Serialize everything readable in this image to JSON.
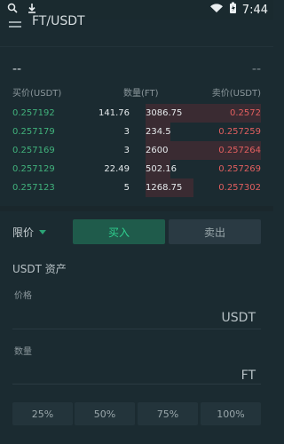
{
  "status": {
    "time": "7:44"
  },
  "header": {
    "title": "FT/USDT"
  },
  "orderbook": {
    "dash_left": "--",
    "dash_right": "--",
    "headers": {
      "buy_price": "买价(USDT)",
      "qty": "数量(FT)",
      "sell_price": "卖价(USDT)"
    },
    "rows": [
      {
        "bid_price": "0.257192",
        "bid_qty": "141.76",
        "ask_qty": "3086.75",
        "ask_price": "0.2572"
      },
      {
        "bid_price": "0.257179",
        "bid_qty": "3",
        "ask_qty": "234.5",
        "ask_price": "0.257259"
      },
      {
        "bid_price": "0.257169",
        "bid_qty": "3",
        "ask_qty": "2600",
        "ask_price": "0.257264"
      },
      {
        "bid_price": "0.257129",
        "bid_qty": "22.49",
        "ask_qty": "502.16",
        "ask_price": "0.257269"
      },
      {
        "bid_price": "0.257123",
        "bid_qty": "5",
        "ask_qty": "1268.75",
        "ask_price": "0.257302"
      }
    ]
  },
  "trade": {
    "order_type": "限价",
    "buy_label": "买入",
    "sell_label": "卖出",
    "asset_label": "USDT  资产",
    "price_label": "价格",
    "price_unit": "USDT",
    "qty_label": "数量",
    "qty_unit": "FT",
    "percents": [
      "25%",
      "50%",
      "75%",
      "100%"
    ]
  }
}
